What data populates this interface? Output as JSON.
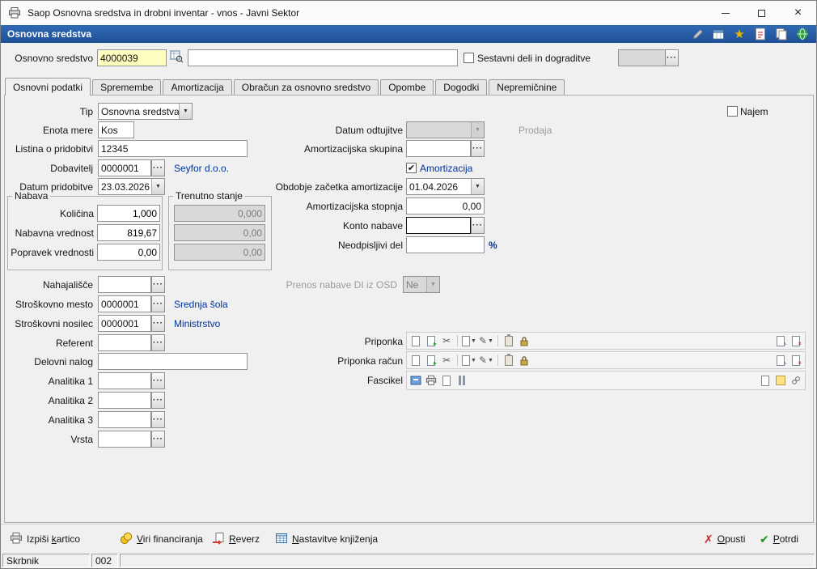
{
  "colors": {
    "header-blue": "#2f6ab5",
    "header-blue-dark": "#1f5096",
    "link-navy": "#003399",
    "required-yellow": "#ffffc0",
    "window-bg": "#f0f0f0",
    "cancel-red": "#c62828",
    "ok-green": "#1b941b",
    "star-gold": "#e7b400"
  },
  "ui": {
    "ellipsis": "···",
    "arrow": "▼",
    "close": "×",
    "cancel_glyph": "✗",
    "ok_glyph": "✔",
    "scissors": "✂",
    "pencil": "✎"
  },
  "window": {
    "title": "Saop Osnovna sredstva in drobni inventar - vnos - Javni Sektor"
  },
  "header": {
    "title": "Osnovna sredstva"
  },
  "asset": {
    "label": "Osnovno sredstvo",
    "code": "4000039",
    "name": "",
    "components_label": "Sestavni deli in dograditve",
    "components_value": ""
  },
  "tabs": [
    "Osnovni podatki",
    "Spremembe",
    "Amortizacija",
    "Obračun za osnovno sredstvo",
    "Opombe",
    "Dogodki",
    "Nepremičnine"
  ],
  "form": {
    "tip": {
      "label": "Tip",
      "value": "Osnovna sredstva"
    },
    "najem": {
      "label": "Najem",
      "check": ""
    },
    "enota": {
      "label": "Enota mere",
      "value": "Kos"
    },
    "odtujitve": {
      "label": "Datum odtujitve",
      "value": ""
    },
    "prodaja": "Prodaja",
    "listina": {
      "label": "Listina o pridobitvi",
      "value": "12345"
    },
    "skupina": {
      "label": "Amortizacijska skupina",
      "value": ""
    },
    "dobavitelj": {
      "label": "Dobavitelj",
      "value": "0000001",
      "link": "Seyfor d.o.o."
    },
    "amortizacija": {
      "label": "Amortizacija",
      "check": "✔"
    },
    "datum_pridobitve": {
      "label": "Datum pridobitve",
      "value": "23.03.2026"
    },
    "obdobje": {
      "label": "Obdobje začetka amortizacije",
      "value": "01.04.2026"
    },
    "stopnja": {
      "label": "Amortizacijska stopnja",
      "value": "0,00"
    },
    "konto": {
      "label": "Konto nabave",
      "value": ""
    },
    "neodpisljivi": {
      "label": "Neodpisljivi del",
      "value": "",
      "suffix": "%"
    },
    "nabava": {
      "title": "Nabava",
      "kolicina": {
        "label": "Količina",
        "value": "1,000"
      },
      "vrednost": {
        "label": "Nabavna vrednost",
        "value": "819,67"
      },
      "popravek": {
        "label": "Popravek vrednosti",
        "value": "0,00"
      }
    },
    "trenutno": {
      "title": "Trenutno stanje",
      "v0": "0,000",
      "v1": "0,00",
      "v2": "0,00"
    },
    "nahajalisce": {
      "label": "Nahajališče",
      "value": ""
    },
    "prenos": {
      "label": "Prenos nabave DI iz OSD",
      "value": "Ne"
    },
    "sm": {
      "label": "Stroškovno mesto",
      "value": "0000001",
      "link": "Srednja šola"
    },
    "sn": {
      "label": "Stroškovni nosilec",
      "value": "0000001",
      "link": "Ministrstvo"
    },
    "referent": {
      "label": "Referent",
      "value": ""
    },
    "delovni_nalog": {
      "label": "Delovni nalog",
      "value": ""
    },
    "a1": {
      "label": "Analitika 1",
      "value": ""
    },
    "a2": {
      "label": "Analitika 2",
      "value": ""
    },
    "a3": {
      "label": "Analitika 3",
      "value": ""
    },
    "vrsta": {
      "label": "Vrsta",
      "value": ""
    },
    "priponka": "Priponka",
    "priponka_racun": "Priponka račun",
    "fascikel": "Fascikel"
  },
  "footer": {
    "print": {
      "pre": "Izpiši ",
      "accel": "k",
      "post": "artico"
    },
    "viri": {
      "pre": "",
      "accel": "V",
      "post": "iri financiranja"
    },
    "reverz": {
      "pre": "",
      "accel": "R",
      "post": "everz"
    },
    "nastavitve": {
      "pre": "",
      "accel": "N",
      "post": "astavitve knjiženja"
    },
    "opusti": {
      "pre": "",
      "accel": "O",
      "post": "pusti"
    },
    "potrdi": {
      "pre": "",
      "accel": "P",
      "post": "otrdi"
    }
  },
  "status": {
    "user": "Skrbnik",
    "station": "002"
  }
}
